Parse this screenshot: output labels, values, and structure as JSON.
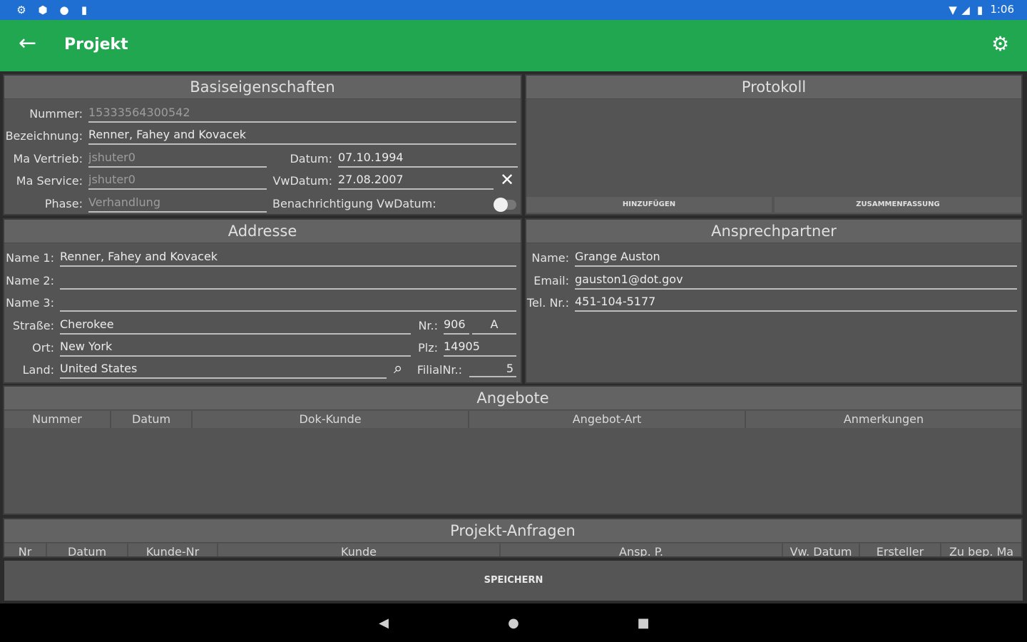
{
  "status_bar": {
    "time": "1:06"
  },
  "app_bar": {
    "title": "Projekt"
  },
  "basis": {
    "title": "Basiseigenschaften",
    "nummer_label": "Nummer:",
    "nummer_value": "15333564300542",
    "bezeichnung_label": "Bezeichnung:",
    "bezeichnung_value": "Renner, Fahey and Kovacek",
    "ma_vertrieb_label": "Ma Vertrieb:",
    "ma_vertrieb_value": "jshuter0",
    "datum_label": "Datum:",
    "datum_value": "07.10.1994",
    "ma_service_label": "Ma Service:",
    "ma_service_value": "jshuter0",
    "vwdatum_label": "VwDatum:",
    "vwdatum_value": "27.08.2007",
    "phase_label": "Phase:",
    "phase_value": "Verhandlung",
    "benachrichtigung_label": "Benachrichtigung VwDatum:"
  },
  "protokoll": {
    "title": "Protokoll",
    "add_label": "HINZUFÜGEN",
    "summary_label": "ZUSAMMENFASSUNG"
  },
  "adresse": {
    "title": "Addresse",
    "name1_label": "Name 1:",
    "name1_value": "Renner, Fahey and Kovacek",
    "name2_label": "Name 2:",
    "name2_value": "",
    "name3_label": "Name 3:",
    "name3_value": "",
    "strasse_label": "Straße:",
    "strasse_value": "Cherokee",
    "nr_label": "Nr.:",
    "nr_value": "906",
    "nr_suffix": "A",
    "ort_label": "Ort:",
    "ort_value": "New York",
    "plz_label": "Plz:",
    "plz_value": "14905",
    "land_label": "Land:",
    "land_value": "United States",
    "filialnr_label": "FilialNr.:",
    "filialnr_value": "5"
  },
  "ansprechpartner": {
    "title": "Ansprechpartner",
    "name_label": "Name:",
    "name_value": "Grange Auston",
    "email_label": "Email:",
    "email_value": "gauston1@dot.gov",
    "tel_label": "Tel. Nr.:",
    "tel_value": "451-104-5177"
  },
  "angebote": {
    "title": "Angebote",
    "columns": [
      "Nummer",
      "Datum",
      "Dok-Kunde",
      "Angebot-Art",
      "Anmerkungen"
    ]
  },
  "anfragen": {
    "title": "Projekt-Anfragen",
    "columns": [
      "Nr",
      "Datum",
      "Kunde-Nr",
      "Kunde",
      "Ansp. P.",
      "Vw. Datum",
      "Ersteller",
      "Zu bep. Ma"
    ]
  },
  "save_label": "SPEICHERN",
  "colors": {
    "status_bar": "#1e6fd1",
    "app_bar": "#21a750",
    "panel": "#545454",
    "background": "#2b2b2b"
  }
}
